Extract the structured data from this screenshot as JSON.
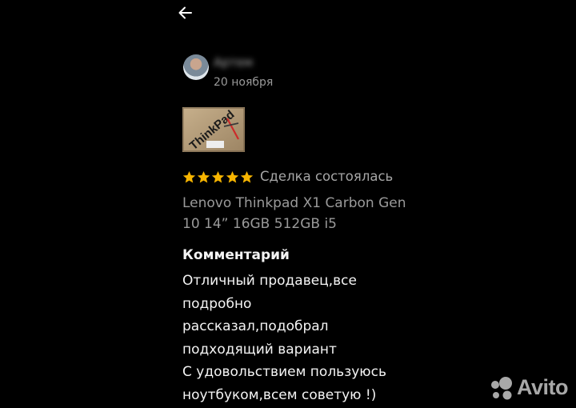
{
  "navigation": {
    "back_icon": "arrow-left-icon"
  },
  "review": {
    "author_name": "Артем",
    "avatar_icon": "user-avatar",
    "date": "20 ноября",
    "photo": {
      "label": "ThinkPad",
      "description": "laptop box"
    },
    "rating": 5,
    "rating_max": 5,
    "star_color": "#f7b500",
    "deal_status": "Сделка состоялась",
    "product_title": "Lenovo Thinkpad X1 Carbon Gen 10 14” 16GB 512GB i5",
    "comment_heading": "Комментарий",
    "comment_lines": [
      "Отличный продавец,все",
      "подробно",
      "рассказал,подобрал",
      "подходящий вариант",
      "С удовольствием пользуюсь",
      "ноутбуком,всем советую !)"
    ]
  },
  "watermark": {
    "brand": "Avito"
  },
  "colors": {
    "background": "#000000",
    "text_primary": "#f4f4f4",
    "text_secondary": "#9a9a9a",
    "star": "#f7b500"
  }
}
